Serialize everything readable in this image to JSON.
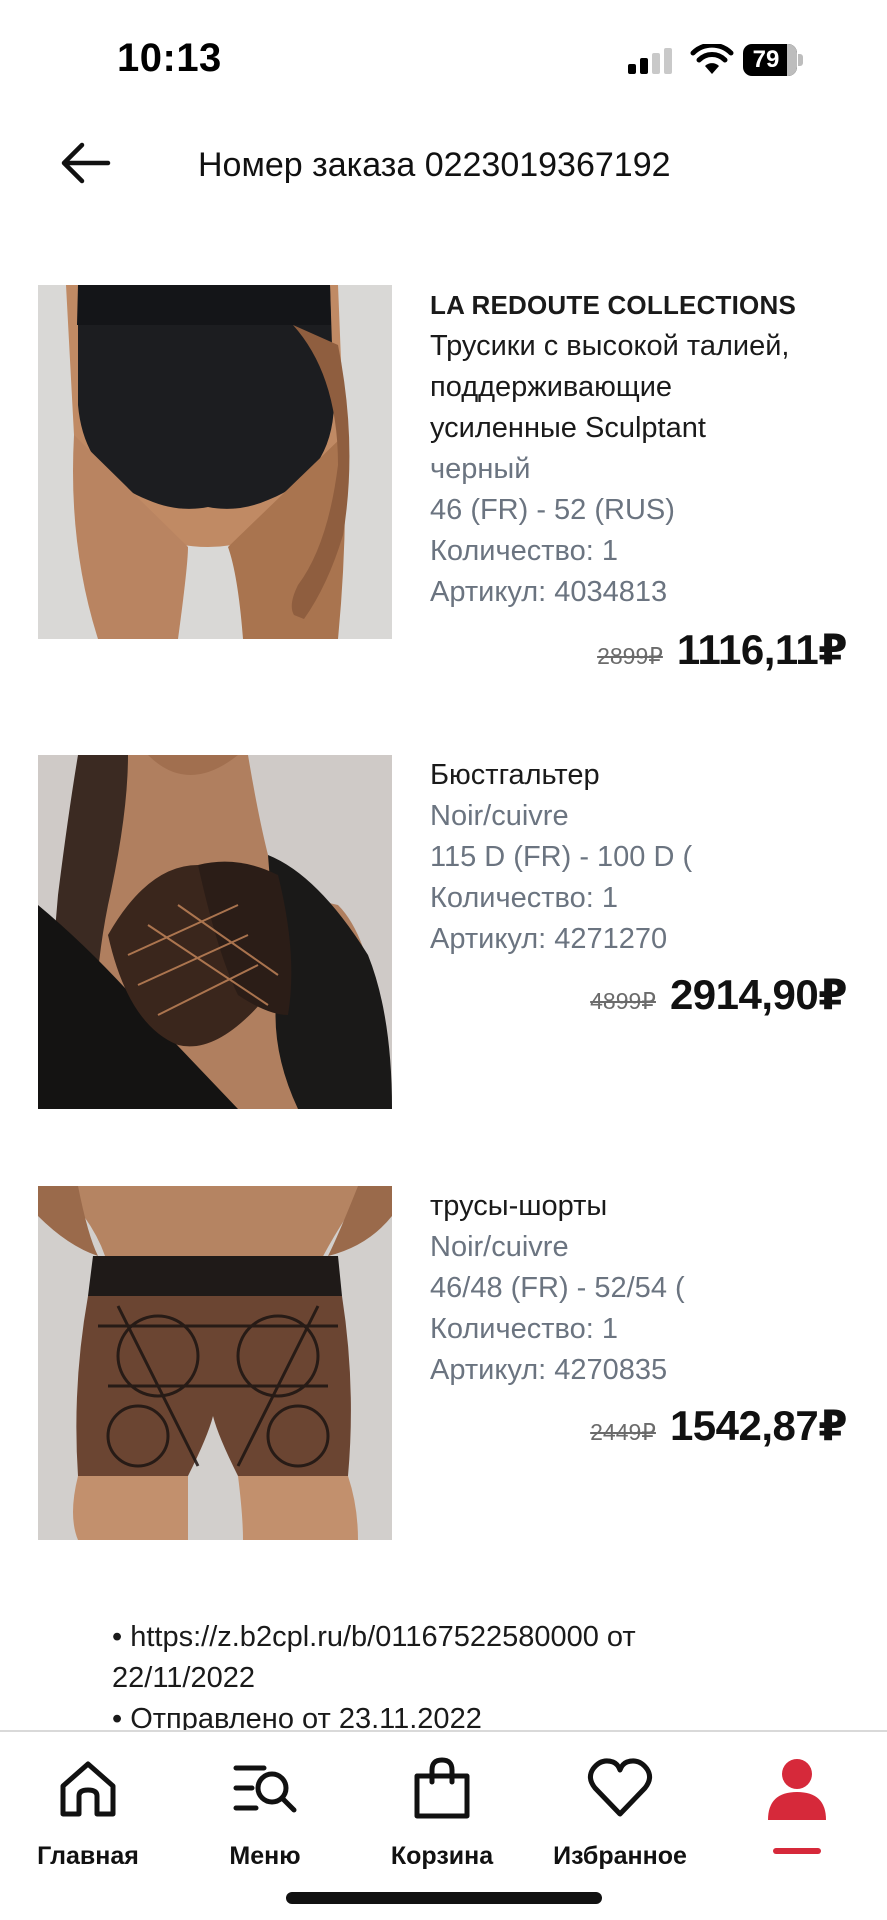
{
  "status_bar": {
    "time": "10:13",
    "battery": "79"
  },
  "header": {
    "title": "Номер заказа 0223019367192"
  },
  "items": [
    {
      "brand": "LA REDOUTE COLLECTIONS",
      "name_lines": [
        "Трусики с высокой талией,",
        "поддерживающие",
        "усиленные Sculptant"
      ],
      "color": "черный",
      "size": "46 (FR) - 52 (RUS)",
      "quantity": "Количество: 1",
      "sku": "Артикул: 4034813",
      "old_price": "2899₽",
      "price": "1116,11₽",
      "image_alt": "high-waist black briefs"
    },
    {
      "brand": "",
      "name_lines": [
        "Бюстгальтер"
      ],
      "color": "Noir/cuivre",
      "size": "115 D (FR) - 100 D (",
      "quantity": "Количество: 1",
      "sku": "Артикул: 4271270",
      "old_price": "4899₽",
      "price": "2914,90₽",
      "image_alt": "lace bra"
    },
    {
      "brand": "",
      "name_lines": [
        "трусы-шорты"
      ],
      "color": "Noir/cuivre",
      "size": "46/48 (FR) - 52/54 (",
      "quantity": "Количество: 1",
      "sku": "Артикул: 4270835",
      "old_price": "2449₽",
      "price": "1542,87₽",
      "image_alt": "lace shorts"
    }
  ],
  "tracking": {
    "line1": "• https://z.b2cpl.ru/b/01167522580000 от",
    "line2": "22/11/2022",
    "line3": "• Отправлено от 23.11.2022"
  },
  "tab_bar": {
    "tabs": [
      {
        "label": "Главная",
        "icon": "home-icon"
      },
      {
        "label": "Меню",
        "icon": "menu-search-icon"
      },
      {
        "label": "Корзина",
        "icon": "bag-icon"
      },
      {
        "label": "Избранное",
        "icon": "heart-icon"
      },
      {
        "label": "",
        "icon": "profile-icon",
        "active": true
      }
    ]
  },
  "colors": {
    "accent": "#d6293a",
    "muted_text": "#6b7480"
  }
}
